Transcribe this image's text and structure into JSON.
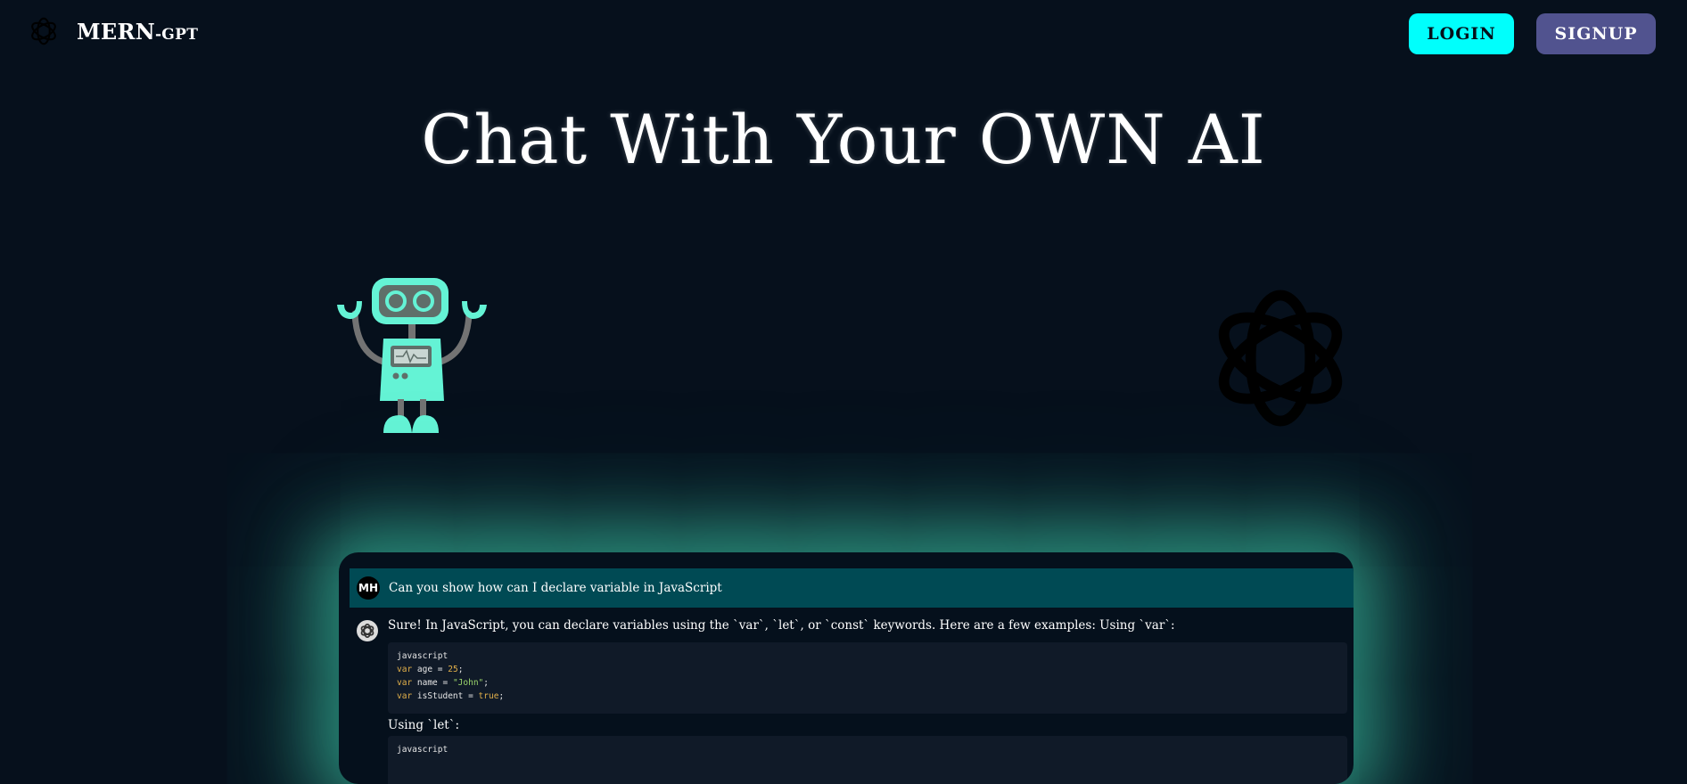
{
  "navbar": {
    "brand_main": "MERN",
    "brand_sub": "-GPT",
    "login_label": "LOGIN",
    "signup_label": "SIGNUP"
  },
  "hero": {
    "title": "Chat With Your OWN AI"
  },
  "chat": {
    "user_initials": "MH",
    "user_message": "Can you show how can I declare variable in JavaScript",
    "bot_message": "Sure! In JavaScript, you can declare variables using the `var`, `let`, or `const` keywords. Here are a few examples: Using `var`:",
    "code_block_1": {
      "language": "javascript",
      "lines": [
        {
          "kw": "var",
          "name": " age ",
          "op": "= ",
          "val": "25",
          "val_type": "num",
          "end": ";"
        },
        {
          "kw": "var",
          "name": " name ",
          "op": "= ",
          "val": "\"John\"",
          "val_type": "str",
          "end": ";"
        },
        {
          "kw": "var",
          "name": " isStudent ",
          "op": "= ",
          "val": "true",
          "val_type": "num",
          "end": ";"
        }
      ]
    },
    "section_label_2": "Using `let`:",
    "code_block_2": {
      "language": "javascript"
    }
  },
  "colors": {
    "background": "#06101c",
    "login_bg": "#00fffc",
    "signup_bg": "#51538f",
    "robot_body": "#64f3d5",
    "user_row_bg": "#004a54",
    "glow": "#3ecca9"
  },
  "icons": {
    "brand": "openai-logo-icon",
    "hero_left": "robot-illustration",
    "hero_right": "openai-logo-icon",
    "bot_avatar": "openai-logo-icon"
  }
}
